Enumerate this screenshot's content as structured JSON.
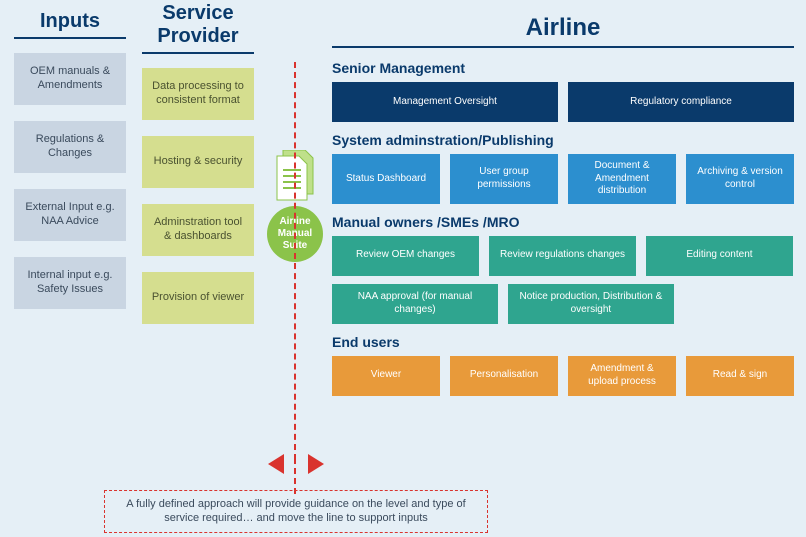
{
  "headers": {
    "inputs": "Inputs",
    "provider_l1": "Service",
    "provider_l2": "Provider",
    "airline": "Airline"
  },
  "inputs": [
    "OEM manuals & Amendments",
    "Regulations & Changes",
    "External Input e.g. NAA Advice",
    "Internal input e.g. Safety Issues"
  ],
  "provider": [
    "Data processing to consistent format",
    "Hosting & security",
    "Adminstration tool & dashboards",
    "Provision of viewer"
  ],
  "suite_label": "Airline Manual Suite",
  "sections": {
    "senior": {
      "title": "Senior Management",
      "items": [
        "Management Oversight",
        "Regulatory compliance"
      ]
    },
    "sysadmin": {
      "title": "System adminstration/Publishing",
      "items": [
        "Status Dashboard",
        "User group permissions",
        "Document & Amendment distribution",
        "Archiving & version control"
      ]
    },
    "manual": {
      "title": "Manual owners /SMEs /MRO",
      "row1": [
        "Review OEM changes",
        "Review regulations changes",
        "Editing content"
      ],
      "row2": [
        "NAA approval (for manual changes)",
        "Notice production, Distribution & oversight"
      ]
    },
    "endusers": {
      "title": "End users",
      "items": [
        "Viewer",
        "Personalisation",
        "Amendment & upload process",
        "Read & sign"
      ]
    }
  },
  "footnote": "A fully defined approach will provide guidance on the level and type of service required… and move the line to support inputs"
}
